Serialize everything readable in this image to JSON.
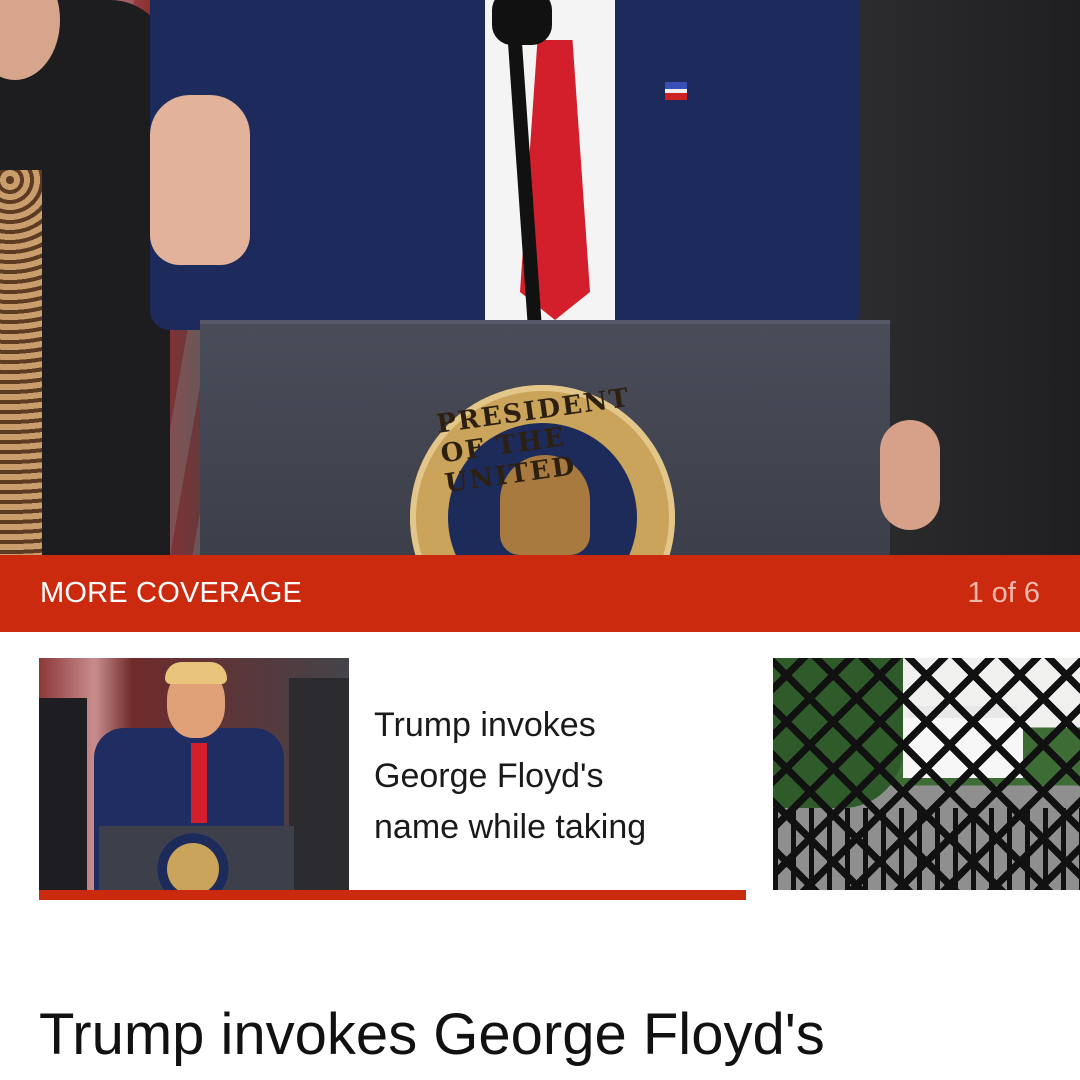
{
  "hero": {
    "seal_text": "PRESIDENT OF THE UNITED"
  },
  "coverage": {
    "title": "MORE COVERAGE",
    "count": "1 of 6",
    "accent_color": "#cc2a0f"
  },
  "carousel": {
    "items": [
      {
        "headline": "Trump invokes\nGeorge Floyd's\nname while taking",
        "progress": 1.0
      },
      {
        "headline": ""
      }
    ]
  },
  "article": {
    "headline": "Trump invokes George Floyd's"
  }
}
